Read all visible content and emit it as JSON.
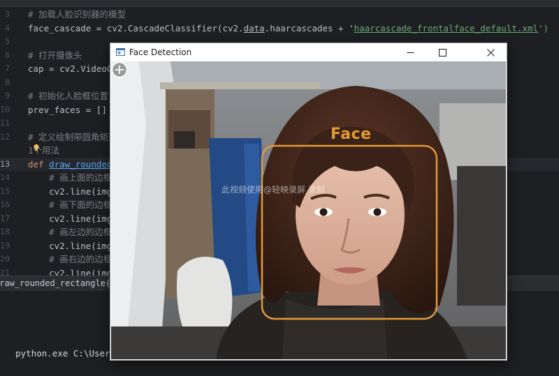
{
  "editor": {
    "lines": [
      {
        "num": "3",
        "segments": [
          [
            "cm",
            "# 加载人脸识别器的模型"
          ]
        ]
      },
      {
        "num": "4",
        "segments": [
          [
            "dim",
            "face_cascade = cv2.CascadeClassifier(cv2."
          ],
          [
            "dim-ul",
            "data"
          ],
          [
            "dim",
            ".haarcascades + '"
          ],
          [
            "str-ul",
            "haarcascade_frontalface_default.xml"
          ],
          [
            "str",
            "')"
          ]
        ]
      },
      {
        "num": "5",
        "segments": []
      },
      {
        "num": "6",
        "segments": [
          [
            "cm",
            "# 打开摄像头"
          ]
        ]
      },
      {
        "num": "7",
        "segments": [
          [
            "dim",
            "cap = cv2.VideoCa"
          ]
        ]
      },
      {
        "num": "8",
        "segments": []
      },
      {
        "num": "9",
        "segments": [
          [
            "cm",
            "# 初始化人脸框位置"
          ]
        ]
      },
      {
        "num": "10",
        "segments": [
          [
            "dim",
            "prev_faces = []"
          ]
        ]
      },
      {
        "num": "11",
        "segments": []
      },
      {
        "num": "12",
        "segments": [
          [
            "cm",
            "# 定义绘制带圆角矩形"
          ]
        ]
      },
      {
        "num": "",
        "segments": [
          [
            "cm",
            "1个用法"
          ]
        ]
      },
      {
        "num": "13",
        "segments": [
          [
            "kw",
            "def "
          ],
          [
            "fn-ul",
            "draw_rounded_"
          ]
        ]
      },
      {
        "num": "14",
        "segments": [
          [
            "cm",
            "    # 画上面的边框"
          ]
        ]
      },
      {
        "num": "15",
        "segments": [
          [
            "dim",
            "    cv2.line(img,"
          ]
        ]
      },
      {
        "num": "16",
        "segments": [
          [
            "cm",
            "    # 画下面的边框"
          ]
        ]
      },
      {
        "num": "17",
        "segments": [
          [
            "dim",
            "    cv2.line(img,"
          ]
        ]
      },
      {
        "num": "18",
        "segments": [
          [
            "cm",
            "    # 画左边的边框"
          ]
        ]
      },
      {
        "num": "19",
        "segments": [
          [
            "dim",
            "    cv2.line(img,"
          ]
        ]
      },
      {
        "num": "20",
        "segments": [
          [
            "cm",
            "    # 画右边的边框"
          ]
        ]
      },
      {
        "num": "21",
        "segments": [
          [
            "dim",
            "    cv2.line(img,"
          ]
        ]
      }
    ],
    "current_line": "13"
  },
  "breadcrumb": {
    "text": "draw_rounded_rectangle()"
  },
  "terminal": {
    "text": "python.exe C:\\Users\\86182"
  },
  "window": {
    "title": "Face Detection",
    "face_label": "Face",
    "watermark": "此视频使用@轻映录屏 录制",
    "box_color": "#e39a35"
  }
}
